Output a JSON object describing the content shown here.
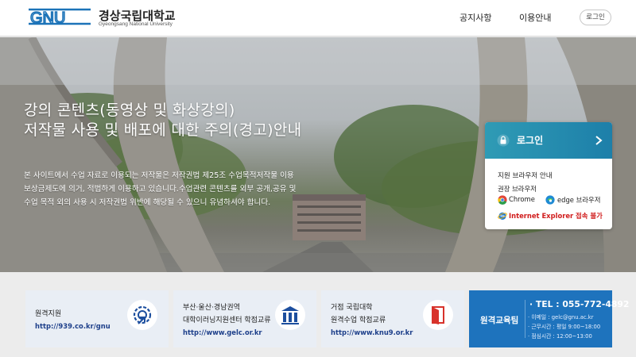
{
  "header": {
    "logo_mark": "GNU",
    "logo_ko": "경상국립대학교",
    "logo_en": "Gyeongsang National University",
    "nav": [
      "공지사항",
      "이용안내"
    ],
    "login_button": "로그인"
  },
  "hero": {
    "title_lines": [
      "강의 콘텐츠(동영상 및 화상강의)",
      "저작물 사용 및 배포에 대한 주의(경고)안내"
    ],
    "desc_lines": [
      "본 사이트에서 수업 자료로 이용되는 저작물은 저작권법 제25조 수업목적저작물 이용",
      "보상금제도에 의거, 적법하게 이용하고 있습니다.수업관련 콘텐츠를 외부 공개,공유 및",
      "수업 목적 외의 사용 시 저작권법 위반에 해당될 수 있으니 유념하셔야 합니다."
    ]
  },
  "login_card": {
    "label": "로그인",
    "browser_title": "지원 브라우저 안내",
    "recommended": "권장 브라우저",
    "chrome": "Chrome",
    "edge": "edge 브라우저",
    "ie_notice": "Internet Explorer 접속 불가"
  },
  "cards": [
    {
      "title_lines": [
        "원격지원"
      ],
      "url": "http://939.co.kr/gnu",
      "icon": "remote-support-icon"
    },
    {
      "title_lines": [
        "부산·울산·경남권역",
        "대학이러닝지원센터 학점교류"
      ],
      "url": "http://www.gelc.or.kr",
      "icon": "gelc-logo-icon"
    },
    {
      "title_lines": [
        "거점 국립대학",
        "원격수업 학점교류"
      ],
      "url": "http://www.knu9.or.kr",
      "icon": "door-icon"
    }
  ],
  "dept": {
    "label": "원격교육팀",
    "tel": "· TEL : 055-772-4892",
    "lines": [
      "· 이메일 : gelc@gnu.ac.kr",
      "· 근무시간 : 평일 9:00~18:00",
      "· 점심시간 : 12:00~13:00"
    ]
  },
  "colors": {
    "brand_blue": "#1e73bd",
    "login_teal": "#2f9bb5",
    "card_bg": "#e9eef5",
    "ie_red": "#d01c1c"
  }
}
